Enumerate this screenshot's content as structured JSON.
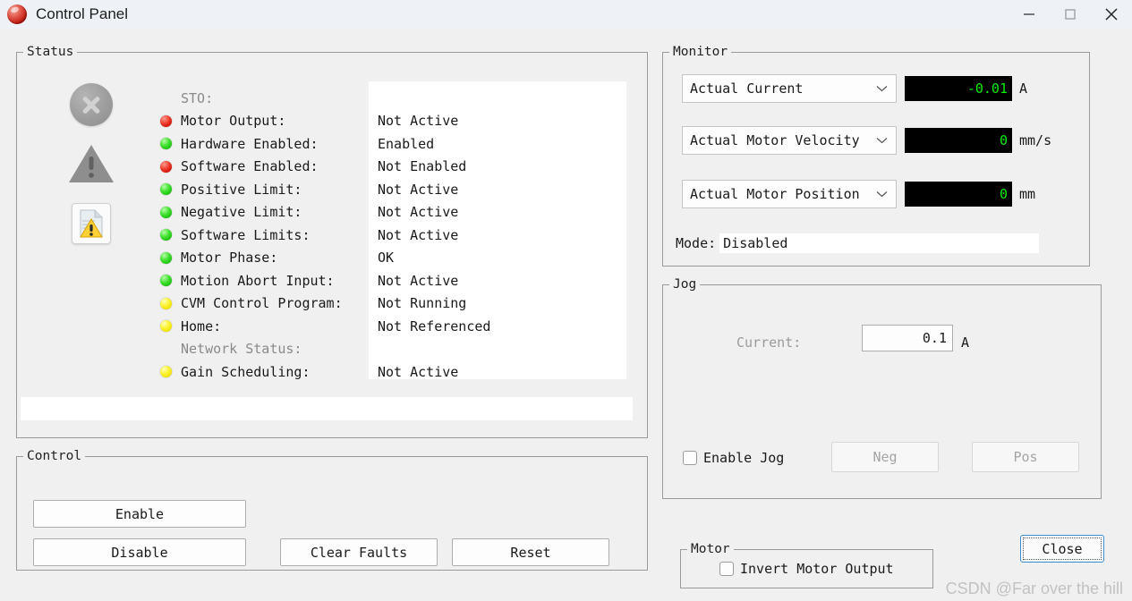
{
  "window": {
    "title": "Control Panel",
    "icon": "app-red-sphere-icon",
    "controls": {
      "minimize": "minimize-icon",
      "maximize": "maximize-icon",
      "close": "close-icon"
    }
  },
  "status": {
    "legend": "Status",
    "icons": [
      {
        "name": "error-disabled-icon"
      },
      {
        "name": "warning-disabled-icon"
      },
      {
        "name": "document-warning-icon"
      }
    ],
    "rows": [
      {
        "led": "none",
        "label": "STO:",
        "value": "",
        "dim": true
      },
      {
        "led": "red",
        "label": "Motor Output:",
        "value": "Not Active",
        "dim": false
      },
      {
        "led": "green",
        "label": "Hardware Enabled:",
        "value": "Enabled",
        "dim": false
      },
      {
        "led": "red",
        "label": "Software Enabled:",
        "value": "Not Enabled",
        "dim": false
      },
      {
        "led": "green",
        "label": "Positive Limit:",
        "value": "Not Active",
        "dim": false
      },
      {
        "led": "green",
        "label": "Negative Limit:",
        "value": "Not Active",
        "dim": false
      },
      {
        "led": "green",
        "label": "Software Limits:",
        "value": "Not Active",
        "dim": false
      },
      {
        "led": "green",
        "label": "Motor Phase:",
        "value": "OK",
        "dim": false
      },
      {
        "led": "green",
        "label": "Motion Abort Input:",
        "value": "Not Active",
        "dim": false
      },
      {
        "led": "yellow",
        "label": "CVM Control Program:",
        "value": "Not Running",
        "dim": false
      },
      {
        "led": "yellow",
        "label": "Home:",
        "value": "Not Referenced",
        "dim": false
      },
      {
        "led": "none",
        "label": "Network Status:",
        "value": "",
        "dim": true
      },
      {
        "led": "yellow",
        "label": "Gain Scheduling:",
        "value": "Not Active",
        "dim": false
      }
    ],
    "message_bar": ""
  },
  "control": {
    "legend": "Control",
    "enable_label": "Enable",
    "disable_label": "Disable",
    "clear_faults_label": "Clear Faults",
    "reset_label": "Reset"
  },
  "monitor": {
    "legend": "Monitor",
    "rows": [
      {
        "selected": "Actual Current",
        "value": "-0.01",
        "unit": "A"
      },
      {
        "selected": "Actual Motor Velocity",
        "value": "0",
        "unit": "mm/s"
      },
      {
        "selected": "Actual Motor Position",
        "value": "0",
        "unit": "mm"
      }
    ],
    "mode_label": "Mode:",
    "mode_value": "Disabled",
    "lcd_color": "#0bec0b"
  },
  "jog": {
    "legend": "Jog",
    "current_label": "Current:",
    "current_value": "0.1",
    "current_unit": "A",
    "enable_label": "Enable Jog",
    "enable_checked": false,
    "neg_label": "Neg",
    "pos_label": "Pos"
  },
  "motor": {
    "legend": "Motor",
    "invert_label": "Invert Motor Output",
    "invert_checked": false
  },
  "footer": {
    "close_label": "Close",
    "watermark": "CSDN @Far over the hill"
  }
}
